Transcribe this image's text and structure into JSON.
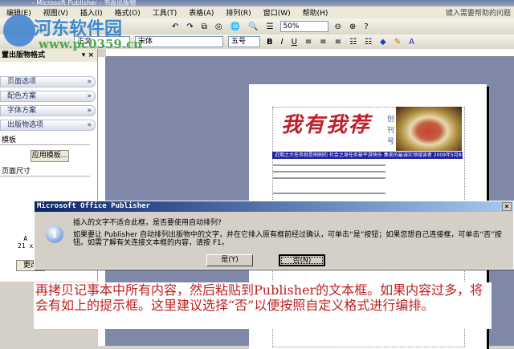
{
  "window": {
    "title": "- Microsoft Publisher - 书面出版物"
  },
  "menu": [
    "编辑(E)",
    "视图(V)",
    "插入(I)",
    "格式(O)",
    "工具(T)",
    "表格(A)",
    "排列(R)",
    "窗口(W)",
    "帮助(H)"
  ],
  "help_placeholder": "键入需要帮助的问题",
  "toolbar": {
    "zoom": "50%",
    "style": "正文",
    "font": "宋体",
    "size": "五号",
    "bold": "B",
    "italic": "I",
    "underline": "U"
  },
  "taskpane": {
    "title": "置出版物格式",
    "sections": [
      "页面选项",
      "配色方案",
      "字体方案",
      "出版物选项"
    ],
    "template_label": "模板",
    "apply_button": "应用模板...",
    "page_size_label": "页面尺寸",
    "size_text": [
      "A",
      "21 x"
    ],
    "change_button": "更改"
  },
  "page": {
    "masthead": "我有我荐",
    "issue": "创刊号",
    "banner": "近期之大任务就是刷刷的 社会之身任务被平游快乐 集美的最诚实领域读者 2009年5月8日"
  },
  "dialog": {
    "title": "Microsoft Office Publisher",
    "question": "插入的文字不适合此框，是否要使用自动排列?",
    "message": "如果要让 Publisher 自动排列出版物中的文字，并在它排入原有框前经过确认，可单击“是”按钮；如果您想自己连接框，可单击“否”按钮。如需了解有关连接文本框的内容，请按 F1。",
    "yes": "是(Y)",
    "no": "否(N)",
    "close": "×",
    "icon": "i"
  },
  "annotation": "再拷贝记事本中所有内容，然后粘贴到Publisher的文本框。如果内容过多，将会有如上的提示框。这里建议选择“否”以便按照自定义格式进行编排。",
  "watermark": {
    "name": "河东软件园",
    "url": "www.pc0359.cn"
  }
}
